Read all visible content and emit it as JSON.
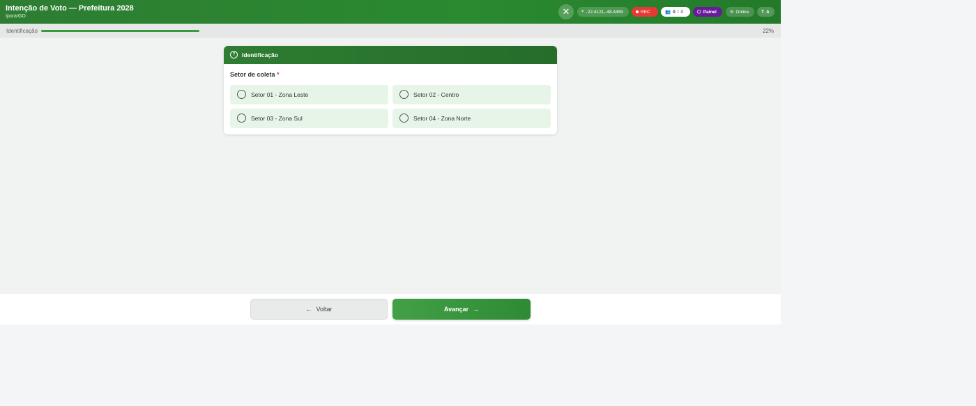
{
  "header": {
    "title": "Intenção de Voto — Prefeitura 2028",
    "subtitle": "Iporá/GO",
    "coords": "-22.4121,-48.4459",
    "rec_label": "REC",
    "count_a": "0",
    "count_b": "0",
    "painel_label": "Painel",
    "online_label": "Online",
    "text_size_label": "A"
  },
  "progress": {
    "label": "Identificação",
    "percent_text": "22%",
    "fraction": 0.22
  },
  "card": {
    "title": "Identificação",
    "question": "Setor de coleta",
    "required_mark": "*",
    "options": [
      {
        "label": "Setor 01 - Zona Leste",
        "selected": false
      },
      {
        "label": "Setor 02 - Centro",
        "selected": false
      },
      {
        "label": "Setor 03 - Zona Sul",
        "selected": false
      },
      {
        "label": "Setor 04 - Zona Norte",
        "selected": false
      }
    ]
  },
  "footer": {
    "back_label": "Voltar",
    "next_label": "Avançar"
  },
  "colors": {
    "brand": "#2e7d32",
    "rec": "#e53935",
    "painel": "#6a1b9a"
  }
}
